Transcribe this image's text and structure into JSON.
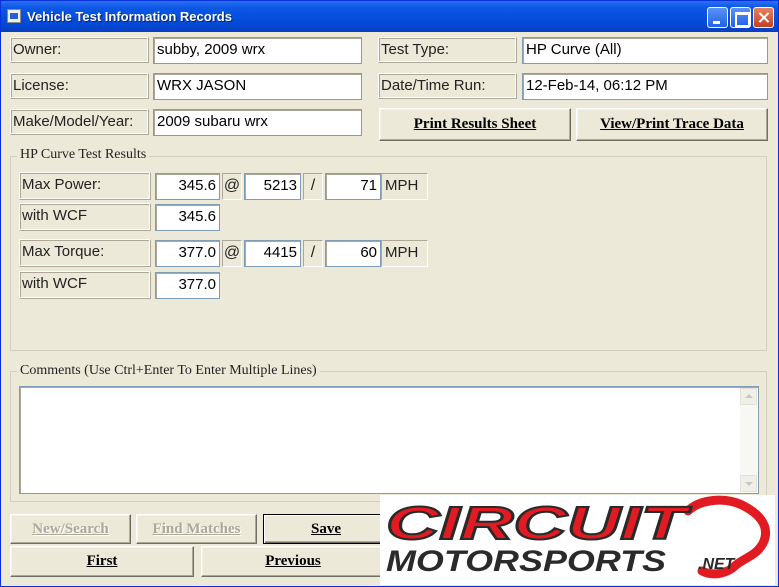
{
  "window": {
    "title": "Vehicle Test Information Records"
  },
  "fields": {
    "owner": {
      "label": "Owner:",
      "value": "subby, 2009 wrx"
    },
    "license": {
      "label": "License:",
      "value": "WRX JASON"
    },
    "make_model_year": {
      "label": "Make/Model/Year:",
      "value": "2009 subaru wrx"
    },
    "test_type": {
      "label": "Test Type:",
      "value": "HP Curve (All)"
    },
    "date_time_run": {
      "label": "Date/Time Run:",
      "value": "12-Feb-14, 06:12 PM"
    }
  },
  "buttons": {
    "print_results": "Print Results Sheet",
    "view_print_trace": "View/Print Trace Data",
    "new_search": "New/Search",
    "find_matches": "Find Matches",
    "save": "Save",
    "first": "First",
    "previous": "Previous"
  },
  "results": {
    "group_title": "HP Curve Test Results",
    "max_power": {
      "label": "Max Power:",
      "value": "345.6",
      "at": "@",
      "rpm": "5213",
      "slash": "/",
      "speed": "71",
      "unit": "MPH"
    },
    "power_wcf": {
      "label": "with WCF",
      "value": "345.6"
    },
    "max_torque": {
      "label": "Max Torque:",
      "value": "377.0",
      "at": "@",
      "rpm": "4415",
      "slash": "/",
      "speed": "60",
      "unit": "MPH"
    },
    "torque_wcf": {
      "label": "with WCF",
      "value": "377.0"
    }
  },
  "comments": {
    "group_title": "Comments (Use Ctrl+Enter To Enter Multiple Lines)",
    "value": ""
  },
  "watermark": {
    "line1": "CIRCUIT",
    "line2": "MOTORSPORTS",
    "suffix": ".NET",
    "color_red": "#e21b23",
    "color_dark": "#2a2a2a"
  }
}
